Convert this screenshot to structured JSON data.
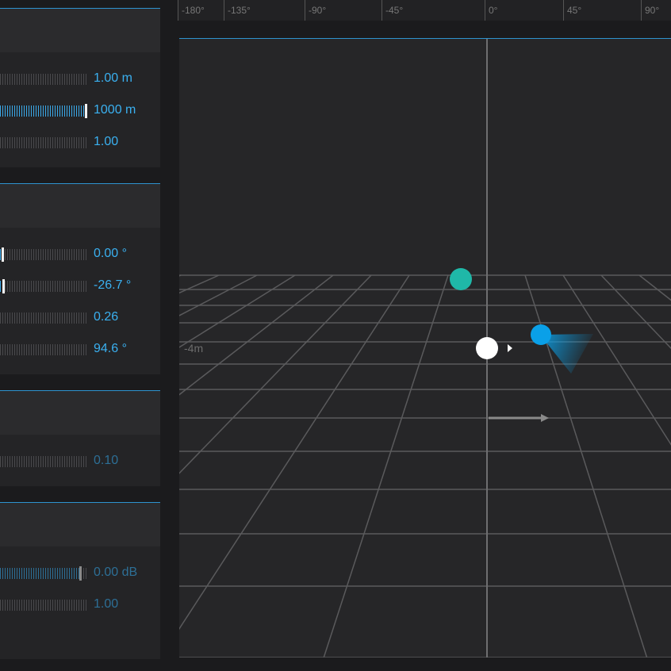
{
  "panels": [
    {
      "rows": [
        {
          "value": "1.00 m",
          "fill": 0.0,
          "dim": false
        },
        {
          "value": "1000 m",
          "fill": 1.0,
          "dim": false
        },
        {
          "value": "1.00",
          "fill": 0.0,
          "dim": false
        }
      ]
    },
    {
      "rows": [
        {
          "value": "0.00 °",
          "fill": 0.02,
          "dim": false
        },
        {
          "value": "-26.7 °",
          "fill": 0.03,
          "dim": false
        },
        {
          "value": "0.26",
          "fill": 0.0,
          "dim": false
        },
        {
          "value": "94.6 °",
          "fill": 0.0,
          "dim": false
        }
      ]
    },
    {
      "rows": [
        {
          "value": "0.10",
          "fill": 0.0,
          "dim": true
        }
      ]
    },
    {
      "rows": [
        {
          "value": "0.00 dB",
          "fill": 0.91,
          "dim": true
        },
        {
          "value": "1.00",
          "fill": 0.0,
          "dim": true
        }
      ]
    }
  ],
  "ruler": {
    "ticks": [
      "-180°",
      "-135°",
      "-90°",
      "-45°",
      "0°",
      "45°",
      "90°"
    ]
  },
  "viewport": {
    "distance_label": "-4m",
    "colors": {
      "accent": "#3aa8e8",
      "source_teal": "#1fb8a8",
      "source_blue": "#0aa0e8",
      "listener": "#ffffff"
    }
  }
}
